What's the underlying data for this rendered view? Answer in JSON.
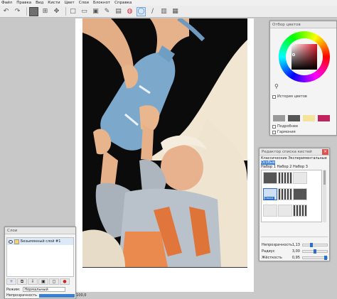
{
  "menu": [
    "Файл",
    "Правка",
    "Вид",
    "Кисти",
    "Цвет",
    "Слои",
    "Блокнот",
    "Справка"
  ],
  "toolbar_icons": [
    "undo-icon",
    "redo-icon",
    "color-swatch",
    "transform-icon",
    "move-icon",
    "new-icon",
    "save-icon",
    "image-icon",
    "brush-icon",
    "layers-icon",
    "color-icon",
    "brush-tool-icon",
    "lasso-icon",
    "brush-settings-icon",
    "layer-panel-icon"
  ],
  "color_panel": {
    "title": "Отбор цветов",
    "history_label": "История цветов",
    "detail_label": "Подробнее",
    "harmony_label": "Гармония",
    "swatches": [
      "#9a9a9a",
      "#555555",
      "#f3e39b",
      "#c2235e"
    ],
    "selected_color": "#e21a2a"
  },
  "brush_panel": {
    "title": "Редактор списка кистей",
    "cat_line1": "Классические  Экспериментальные",
    "cat_highlight": "Особые",
    "cat_line2": "Набор 1  Набор 2  Набор 3",
    "selected_brush_tag": "Classic",
    "opacity_label": "Непрозрачность",
    "opacity_value": "1,13",
    "radius_label": "Радиус",
    "radius_value": "3,00",
    "hardness_label": "Жёсткость",
    "hardness_value": "0,95"
  },
  "layers_panel": {
    "title": "Слои",
    "layer_name": "Безымянный слой #1",
    "mode_label": "Режим:",
    "mode_value": "Нормальный",
    "opacity_label": "Непрозрачность",
    "opacity_value": "100,0"
  },
  "colors": {
    "background_black": "#0a0a0a",
    "skin": "#e7b58f",
    "bottle": "#7aa6c9",
    "sleeve_gray": "#a8b0b8",
    "overall_orange": "#e0753a",
    "hair_cream": "#f2e7d2"
  }
}
